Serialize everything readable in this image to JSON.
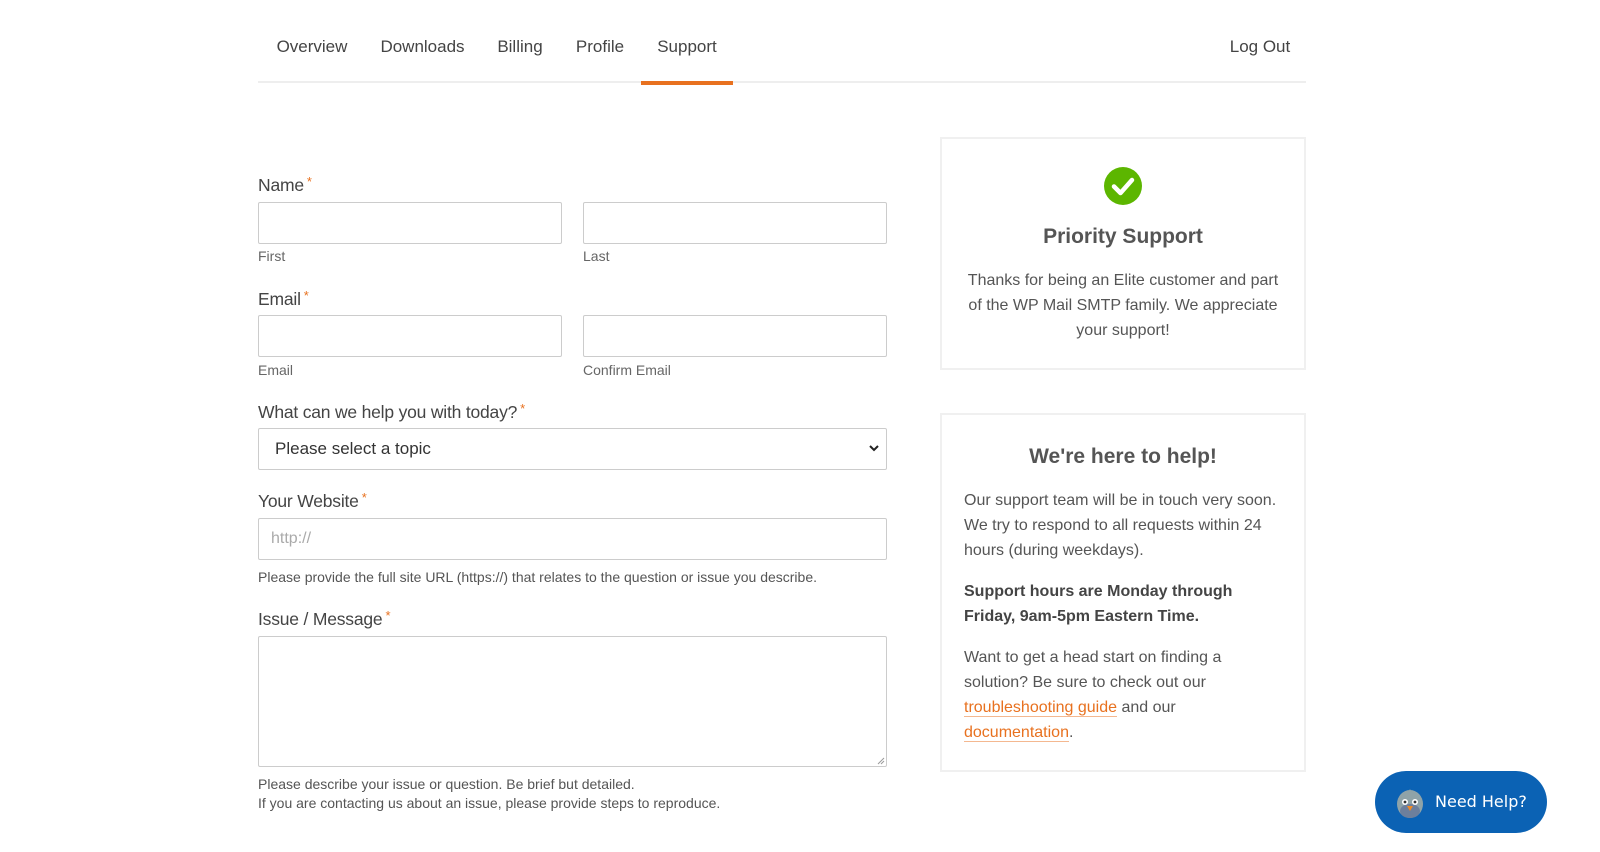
{
  "nav": {
    "tabs": [
      {
        "label": "Overview",
        "active": false
      },
      {
        "label": "Downloads",
        "active": false
      },
      {
        "label": "Billing",
        "active": false
      },
      {
        "label": "Profile",
        "active": false
      },
      {
        "label": "Support",
        "active": true
      }
    ],
    "logout_label": "Log Out"
  },
  "form": {
    "required_mark": "*",
    "name": {
      "label": "Name",
      "first_sublabel": "First",
      "last_sublabel": "Last",
      "first_value": "",
      "last_value": ""
    },
    "email": {
      "label": "Email",
      "email_sublabel": "Email",
      "confirm_sublabel": "Confirm Email",
      "email_value": "",
      "confirm_value": ""
    },
    "topic": {
      "label": "What can we help you with today?",
      "selected": "Please select a topic"
    },
    "website": {
      "label": "Your Website",
      "placeholder": "http://",
      "value": "",
      "help": "Please provide the full site URL (https://) that relates to the question or issue you describe."
    },
    "message": {
      "label": "Issue / Message",
      "value": "",
      "help_line1": "Please describe your issue or question. Be brief but detailed.",
      "help_line2": "If you are contacting us about an issue, please provide steps to reproduce."
    }
  },
  "priority_card": {
    "icon": "check-circle-icon",
    "title": "Priority Support",
    "text": "Thanks for being an Elite customer and part of the WP Mail SMTP family. We appreciate your support!"
  },
  "help_card": {
    "title": "We're here to help!",
    "para1": "Our support team will be in touch very soon. We try to respond to all requests within 24 hours (during weekdays).",
    "para2": "Support hours are Monday through Friday, 9am-5pm Eastern Time.",
    "para3_prefix": "Want to get a head start on finding a solution? Be sure to check out our ",
    "link1": "troubleshooting guide",
    "para3_mid": " and our ",
    "link2": "documentation",
    "para3_suffix": "."
  },
  "help_widget": {
    "label": "Need Help?",
    "icon": "bird-mascot-icon"
  },
  "colors": {
    "accent": "#e8711f",
    "success": "#5cb600",
    "help_button": "#0b62b4"
  }
}
